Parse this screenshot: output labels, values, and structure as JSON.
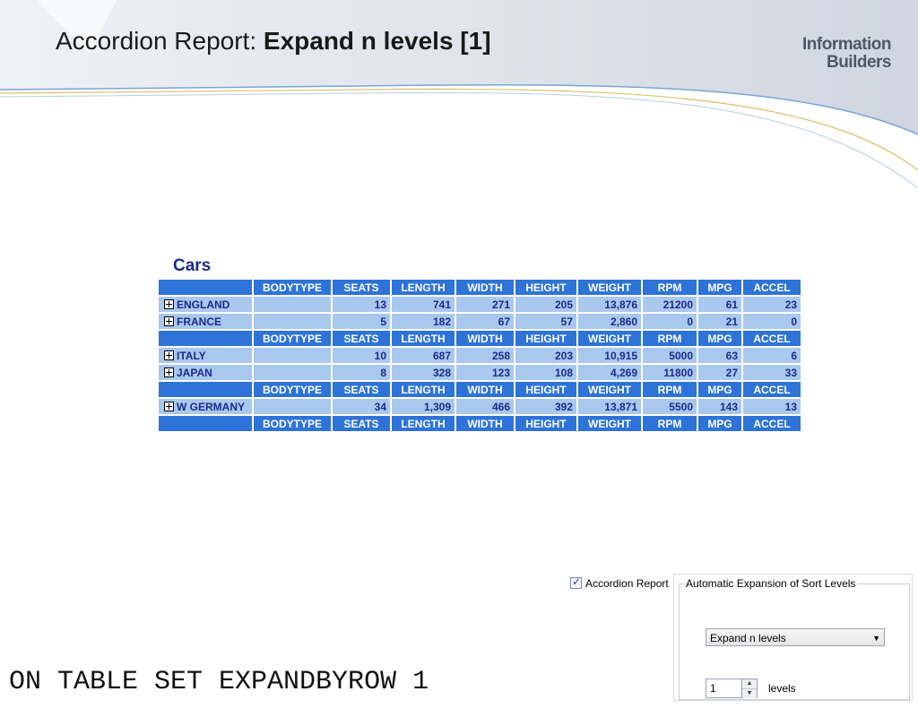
{
  "slide": {
    "title_plain": "Accordion Report: ",
    "title_bold": "Expand n levels [1]",
    "logo_line1": "Information",
    "logo_line2": "Builders",
    "code_text": "ON TABLE SET EXPANDBYROW 1"
  },
  "report": {
    "title": "Cars",
    "header": [
      "BODYTYPE",
      "SEATS",
      "LENGTH",
      "WIDTH",
      "HEIGHT",
      "WEIGHT",
      "RPM",
      "MPG",
      "ACCEL"
    ],
    "rows": [
      {
        "country": "ENGLAND",
        "values": [
          "",
          "13",
          "741",
          "271",
          "205",
          "13,876",
          "21200",
          "61",
          "23"
        ]
      },
      {
        "country": "FRANCE",
        "values": [
          "",
          "5",
          "182",
          "67",
          "57",
          "2,860",
          "0",
          "21",
          "0"
        ]
      },
      {
        "country": "ITALY",
        "values": [
          "",
          "10",
          "687",
          "258",
          "203",
          "10,915",
          "5000",
          "63",
          "6"
        ]
      },
      {
        "country": "JAPAN",
        "values": [
          "",
          "8",
          "328",
          "123",
          "108",
          "4,269",
          "11800",
          "27",
          "33"
        ]
      },
      {
        "country": "W GERMANY",
        "values": [
          "",
          "34",
          "1,309",
          "466",
          "392",
          "13,871",
          "5500",
          "143",
          "13"
        ]
      }
    ]
  },
  "settings": {
    "accordion_label": "Accordion Report",
    "accordion_checked": true,
    "group_label": "Automatic Expansion of Sort Levels",
    "dropdown_value": "Expand n levels",
    "levels_value": "1",
    "levels_label": "levels"
  },
  "colors": {
    "header_bg": "#2e73d8",
    "row_bg": "#a9c8ee",
    "row_text": "#1c2a8c"
  }
}
